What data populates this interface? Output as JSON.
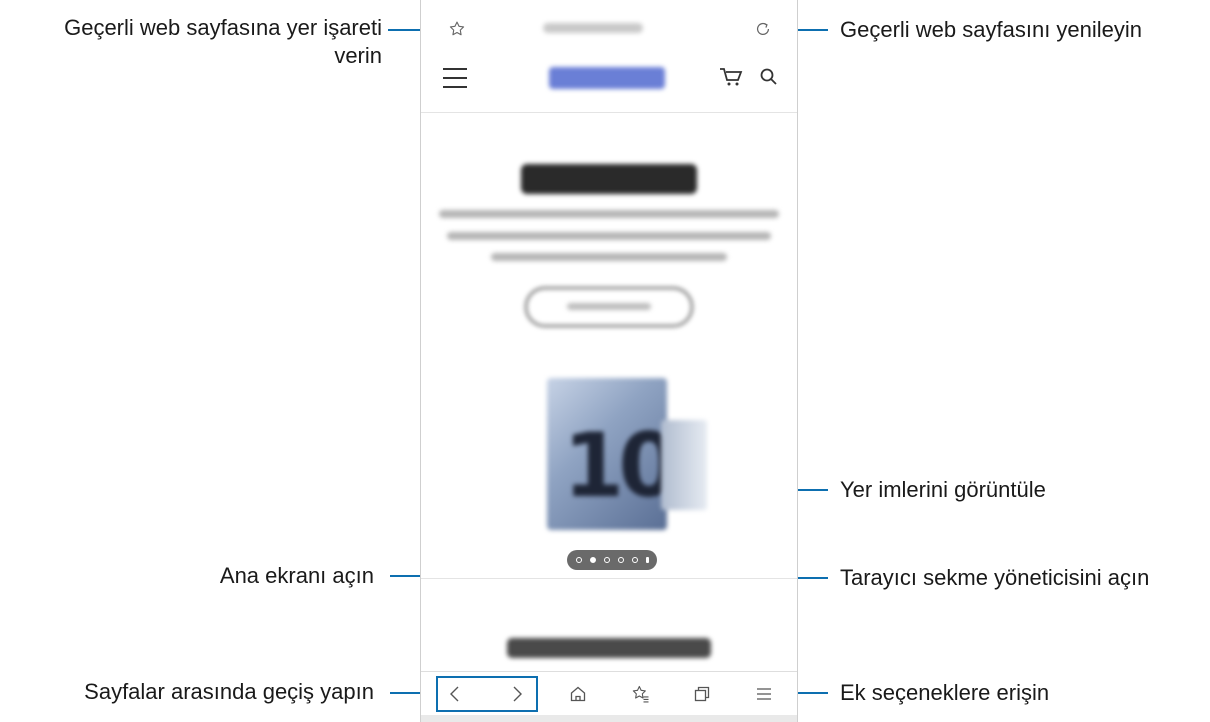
{
  "callouts": {
    "bookmark": "Geçerli web sayfasına yer işareti\nverin",
    "refresh": "Geçerli web sayfasını yenileyin",
    "bookmarks_view": "Yer imlerini görüntüle",
    "home": "Ana ekranı açın",
    "tabs": "Tarayıcı sekme yöneticisini açın",
    "navigate": "Sayfalar arasında geçiş yapın",
    "more": "Ek seçeneklere erişin"
  },
  "browser": {
    "hero_graphic": "10"
  },
  "icons": {
    "bookmark": "star-icon",
    "refresh": "refresh-icon",
    "menu": "hamburger-icon",
    "cart": "cart-icon",
    "search": "search-icon",
    "back": "chevron-left-icon",
    "forward": "chevron-right-icon",
    "home": "home-icon",
    "bookmarks": "bookmarks-icon",
    "tabs": "tabs-icon",
    "more": "menu-icon"
  },
  "colors": {
    "callout_line": "#0d6fb0",
    "icon": "#555555"
  }
}
